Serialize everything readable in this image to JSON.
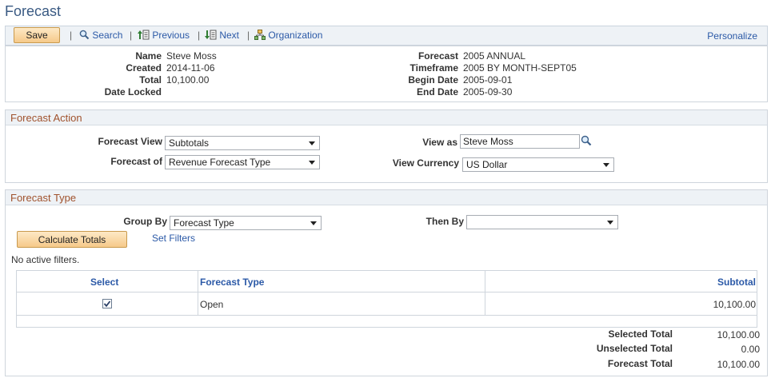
{
  "page": {
    "title": "Forecast"
  },
  "toolbar": {
    "save_label": "Save",
    "search_label": "Search",
    "previous_label": "Previous",
    "next_label": "Next",
    "organization_label": "Organization",
    "personalize_label": "Personalize",
    "separator": "|"
  },
  "header_info": {
    "name_label": "Name",
    "name_value": "Steve Moss",
    "created_label": "Created",
    "created_value": "2014-11-06",
    "total_label": "Total",
    "total_value": "10,100.00",
    "date_locked_label": "Date Locked",
    "date_locked_value": "",
    "forecast_label": "Forecast",
    "forecast_value": "2005 ANNUAL",
    "timeframe_label": "Timeframe",
    "timeframe_value": "2005 BY MONTH-SEPT05",
    "begin_date_label": "Begin Date",
    "begin_date_value": "2005-09-01",
    "end_date_label": "End Date",
    "end_date_value": "2005-09-30"
  },
  "forecast_action": {
    "section_title": "Forecast Action",
    "forecast_view_label": "Forecast View",
    "forecast_view_value": "Subtotals",
    "forecast_of_label": "Forecast of",
    "forecast_of_value": "Revenue Forecast Type",
    "view_as_label": "View as",
    "view_as_value": "Steve Moss",
    "view_currency_label": "View Currency",
    "view_currency_value": "US Dollar"
  },
  "forecast_type": {
    "section_title": "Forecast Type",
    "group_by_label": "Group By",
    "group_by_value": "Forecast Type",
    "then_by_label": "Then By",
    "then_by_value": "",
    "calculate_totals_label": "Calculate Totals",
    "set_filters_label": "Set Filters",
    "no_filters_text": "No active filters.",
    "grid": {
      "columns": {
        "select": "Select",
        "forecast_type": "Forecast Type",
        "subtotal": "Subtotal"
      },
      "rows": [
        {
          "selected": true,
          "forecast_type": "Open",
          "subtotal": "10,100.00"
        }
      ]
    },
    "totals": {
      "selected_label": "Selected Total",
      "selected_value": "10,100.00",
      "unselected_label": "Unselected Total",
      "unselected_value": "0.00",
      "forecast_label": "Forecast Total",
      "forecast_value": "10,100.00"
    }
  },
  "colors": {
    "link": "#2b59a7",
    "section_title": "#a0522d",
    "page_title": "#3a5a83",
    "button": "#f6c98a"
  },
  "icons": [
    "search-icon",
    "previous-icon",
    "next-icon",
    "organization-icon",
    "lookup-icon",
    "checkbox-checked-icon"
  ]
}
